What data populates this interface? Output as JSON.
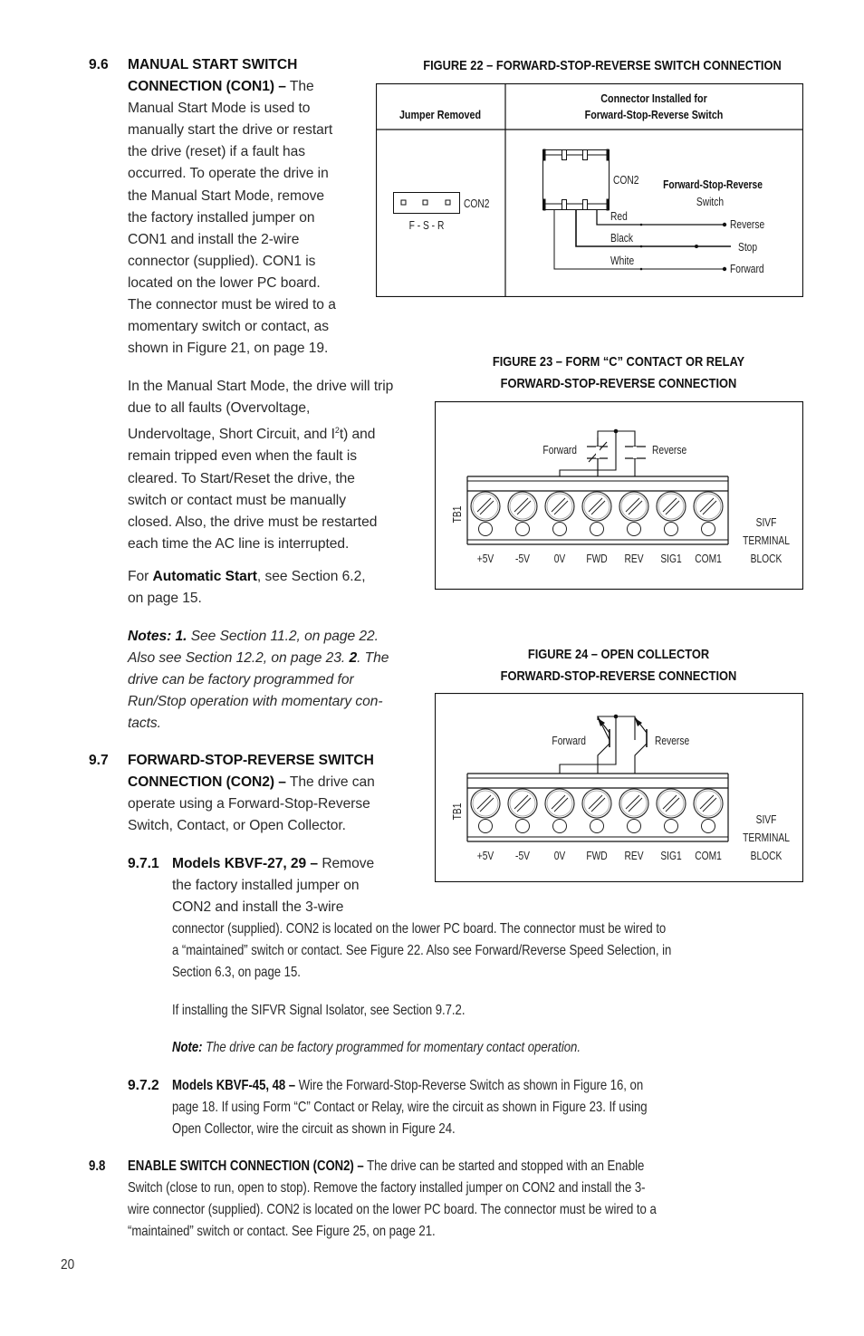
{
  "page_number": "20",
  "sections": {
    "s96": {
      "number": "9.6",
      "heading_line1": "MANUAL START SWITCH",
      "heading_line2": "CONNECTION (CON1) –",
      "lines": [
        " The",
        "Manual Start Mode is used to",
        "manually start the drive or restart",
        "the drive (reset) if a fault has",
        "occurred. To operate the drive in",
        "the Manual Start Mode, remove",
        "the factory installed jumper on",
        "CON1 and install the 2-wire",
        "connector (supplied). CON1 is",
        "located on the lower PC board.",
        "The connector must be wired to a",
        "momentary switch or contact, as",
        "shown in Figure 21, on page 19."
      ],
      "para2_lines": [
        "In the Manual Start Mode, the drive will trip",
        "due to all faults (Overvoltage,",
        "Undervoltage, Short Circuit, and I",
        "remain tripped even when the fault is",
        "cleared. To Start/Reset the drive, the",
        "switch or contact must be manually",
        "closed. Also, the drive must be restarted",
        "each time the AC line is interrupted."
      ],
      "i2t_sup": "2",
      "i2t_tail": "t) and",
      "para3_prefix": "For ",
      "para3_bold": "Automatic Start",
      "para3_suffix": ", see Section 6.2,",
      "para3_line2": "on page 15.",
      "notes_label": "Notes: 1.",
      "notes_l1": " See Section 11.2, on page 22.",
      "notes_l2a": "Also see Section 12.2, on page 23. ",
      "notes_l2b": "2",
      "notes_l2c": ". The",
      "notes_l3": "drive can be factory programmed for",
      "notes_l4": "Run/Stop operation with momentary con-",
      "notes_l5": "tacts."
    },
    "s97": {
      "number": "9.7",
      "heading_line1": "FORWARD-STOP-REVERSE SWITCH",
      "heading_line2": "CONNECTION (CON2) –",
      "l2_tail": " The drive can",
      "l3": "operate using a Forward-Stop-Reverse",
      "l4": "Switch, Contact, or Open Collector."
    },
    "s971": {
      "number": "9.7.1",
      "heading": "Models KBVF-27, 29 –",
      "l1_tail": " Remove",
      "l2": "the factory installed jumper on",
      "l3": "CON2 and install the 3-wire",
      "wide_lines": [
        "connector (supplied). CON2 is located on the lower PC board. The connector must be wired to",
        "a “maintained” switch or contact. See Figure 22. Also see Forward/Reverse Speed Selection, in",
        "Section 6.3, on page 15."
      ],
      "sifvr_line": "If installing the SIFVR Signal Isolator, see Section 9.7.2.",
      "note_label": "Note:",
      "note_text": " The drive can be factory programmed for momentary contact operation."
    },
    "s972": {
      "number": "9.7.2",
      "heading": "Models KBVF-45, 48 –",
      "lines": [
        " Wire the Forward-Stop-Reverse Switch as shown in Figure 16, on",
        "page 18. If using Form “C” Contact or Relay, wire the circuit as shown in Figure 23. If using",
        "Open Collector, wire the circuit as shown in Figure 24."
      ]
    },
    "s98": {
      "number": "9.8",
      "heading": "ENABLE SWITCH CONNECTION (CON2) –",
      "lines": [
        " The drive can be started and stopped with an Enable",
        "Switch (close to run, open to stop). Remove the factory installed jumper on CON2 and install the 3-",
        "wire connector (supplied). CON2 is located on the lower PC board. The connector must be wired to a",
        "“maintained” switch or contact. See Figure 25, on page 21."
      ]
    }
  },
  "figure22": {
    "title": "FIGURE 22 – FORWARD-STOP-REVERSE SWITCH CONNECTION",
    "col1_header": "Jumper Removed",
    "col2_header_l1": "Connector Installed for",
    "col2_header_l2": "Forward-Stop-Reverse Switch",
    "jumper_label": "CON2",
    "jumper_pins": "F - S - R",
    "connector_label": "CON2",
    "switch_label_l1": "Forward-Stop-Reverse",
    "switch_label_l2": "Switch",
    "wires": [
      {
        "color_name": "Red",
        "terminal": "Reverse"
      },
      {
        "color_name": "Black",
        "terminal": "Stop"
      },
      {
        "color_name": "White",
        "terminal": "Forward"
      }
    ]
  },
  "figure23": {
    "title_l1": "FIGURE 23 – FORM “C” CONTACT OR RELAY",
    "title_l2": "FORWARD-STOP-REVERSE CONNECTION",
    "forward_label": "Forward",
    "reverse_label": "Reverse",
    "tb_label": "TB1",
    "terminals": [
      "+5V",
      "-5V",
      "0V",
      "FWD",
      "REV",
      "SIG1",
      "COM1"
    ],
    "block_label": [
      "SIVF",
      "TERMINAL",
      "BLOCK"
    ]
  },
  "figure24": {
    "title_l1": "FIGURE 24 – OPEN COLLECTOR",
    "title_l2": "FORWARD-STOP-REVERSE CONNECTION",
    "forward_label": "Forward",
    "reverse_label": "Reverse",
    "tb_label": "TB1",
    "terminals": [
      "+5V",
      "-5V",
      "0V",
      "FWD",
      "REV",
      "SIG1",
      "COM1"
    ],
    "block_label": [
      "SIVF",
      "TERMINAL",
      "BLOCK"
    ]
  }
}
